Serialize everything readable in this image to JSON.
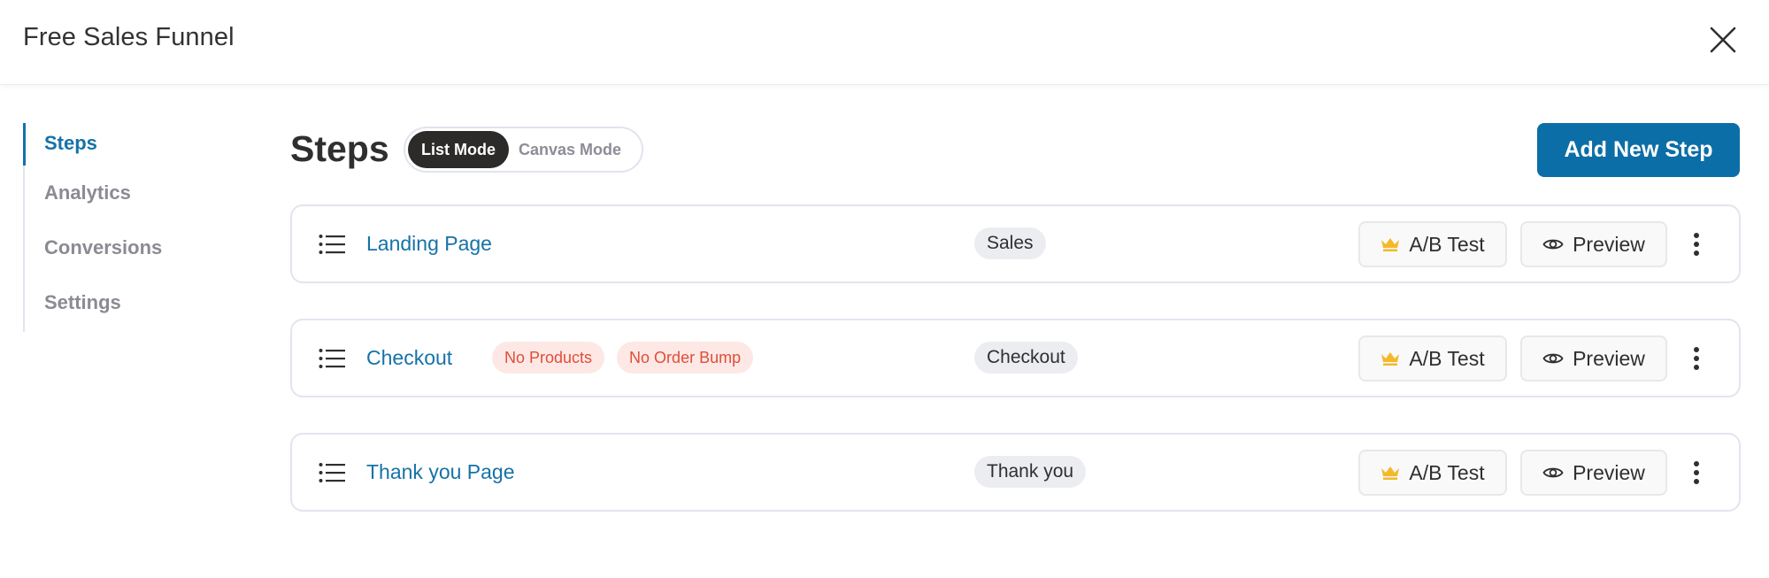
{
  "header": {
    "title": "Free Sales Funnel",
    "close_icon": "close-icon"
  },
  "sidebar": {
    "items": [
      {
        "label": "Steps",
        "active": true
      },
      {
        "label": "Analytics",
        "active": false
      },
      {
        "label": "Conversions",
        "active": false
      },
      {
        "label": "Settings",
        "active": false
      }
    ]
  },
  "main": {
    "title": "Steps",
    "modes": [
      {
        "label": "List Mode",
        "active": true
      },
      {
        "label": "Canvas Mode",
        "active": false
      }
    ],
    "add_step_label": "Add New Step"
  },
  "colors": {
    "accent": "#0c6ea6",
    "link": "#1672a8",
    "warning_text": "#e04e36",
    "warning_bg": "#fde8e6",
    "crown": "#f3b928"
  },
  "steps": [
    {
      "name": "Landing Page",
      "warnings": [],
      "type": "Sales",
      "ab_test_label": "A/B Test",
      "preview_label": "Preview"
    },
    {
      "name": "Checkout",
      "warnings": [
        "No Products",
        "No Order Bump"
      ],
      "type": "Checkout",
      "ab_test_label": "A/B Test",
      "preview_label": "Preview"
    },
    {
      "name": "Thank you Page",
      "warnings": [],
      "type": "Thank you",
      "ab_test_label": "A/B Test",
      "preview_label": "Preview"
    }
  ]
}
